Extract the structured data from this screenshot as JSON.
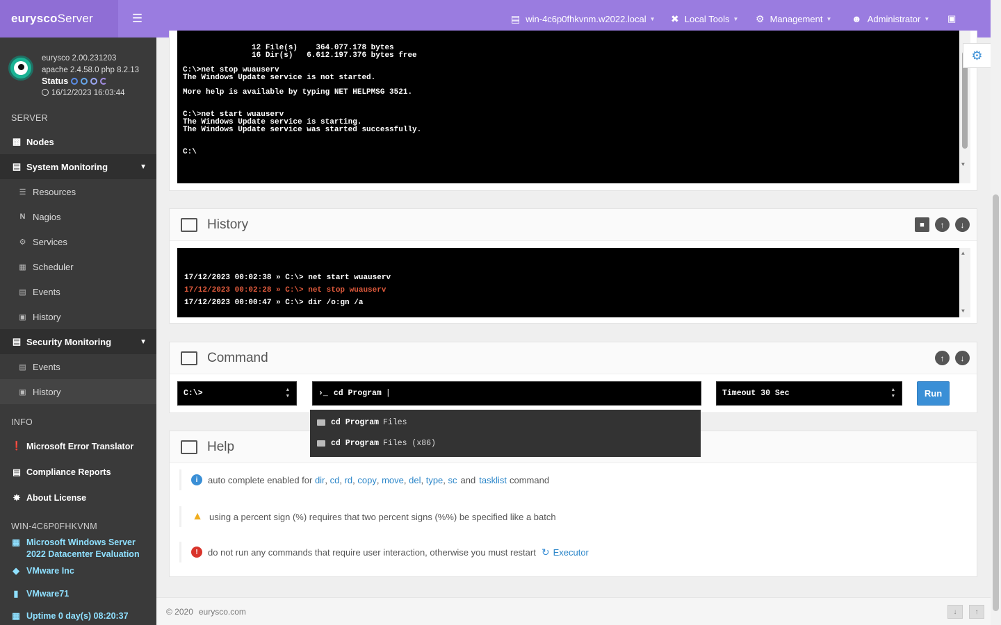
{
  "brand": {
    "prefix": "eurysco",
    "suffix": "Server"
  },
  "profile": {
    "version": "eurysco 2.00.231203",
    "stack": "apache 2.4.58.0  php 8.2.13",
    "status_label": "Status",
    "datetime": "16/12/2023 16:03:44"
  },
  "sidebar": {
    "server_section": "SERVER",
    "nodes": "Nodes",
    "system_monitoring": "System Monitoring",
    "system_items": [
      "Resources",
      "Nagios",
      "Services",
      "Scheduler",
      "Events",
      "History"
    ],
    "security_monitoring": "Security Monitoring",
    "security_items": [
      "Events",
      "History"
    ],
    "info_section": "INFO",
    "info_items": [
      "Microsoft Error Translator",
      "Compliance Reports",
      "About License"
    ],
    "host_section": "WIN-4C6P0FHKVNM",
    "os": "Microsoft  Windows  Server 2022  Datacenter  Evaluation",
    "vendor": "VMware Inc",
    "model": "VMware71",
    "uptime": "Uptime 0 day(s) 08:20:37"
  },
  "topbar": {
    "host": "win-4c6p0fhkvnm.w2022.local",
    "local_tools": "Local Tools",
    "management": "Management",
    "user": "Administrator"
  },
  "output": {
    "lines": [
      "               12 File(s)    364.077.178 bytes",
      "               16 Dir(s)   6.612.197.376 bytes free",
      "",
      "C:\\>net stop wuauserv",
      "The Windows Update service is not started.",
      "",
      "More help is available by typing NET HELPMSG 3521.",
      "",
      "",
      "C:\\>net start wuauserv",
      "The Windows Update service is starting.",
      "The Windows Update service was started successfully.",
      "",
      "",
      "C:\\"
    ]
  },
  "history": {
    "title": "History",
    "entries": [
      {
        "text": "17/12/2023 00:02:38 » C:\\> net start wuauserv",
        "error": false
      },
      {
        "text": "17/12/2023 00:02:28 » C:\\> net stop wuauserv",
        "error": true
      },
      {
        "text": "17/12/2023 00:00:47 » C:\\> dir /o:gn /a",
        "error": false
      }
    ]
  },
  "command": {
    "title": "Command",
    "path": "C:\\>",
    "prompt_symbol": "›_",
    "input_value": "cd Program",
    "timeout": "Timeout 30 Sec",
    "run_label": "Run",
    "suggestions": [
      {
        "bold": "cd Program",
        "rest": "Files"
      },
      {
        "bold": "cd Program",
        "rest": "Files (x86)"
      }
    ]
  },
  "help": {
    "title": "Help",
    "row1": {
      "before": "auto complete enabled for ",
      "links": [
        "dir",
        "cd",
        "rd",
        "copy",
        "move",
        "del",
        "type",
        "sc"
      ],
      "and": "and",
      "last_link": "tasklist",
      "after": "command"
    },
    "row2": "using a percent sign (%) requires that two percent signs (%%) be specified like a batch",
    "row3": {
      "text": "do not run any commands that require user interaction, otherwise you must restart",
      "link": "Executor"
    }
  },
  "footer": {
    "copyright": "© 2020",
    "site": "eurysco.com"
  },
  "colors": {
    "brand": "#8f6ed5",
    "topbar": "#9a7ce0",
    "sidebar": "#3a3a3a",
    "accent": "#3a8fd6",
    "error": "#e05a3c",
    "warning": "#f0ad1e",
    "info": "#3a8fd6",
    "danger": "#d9342b"
  }
}
